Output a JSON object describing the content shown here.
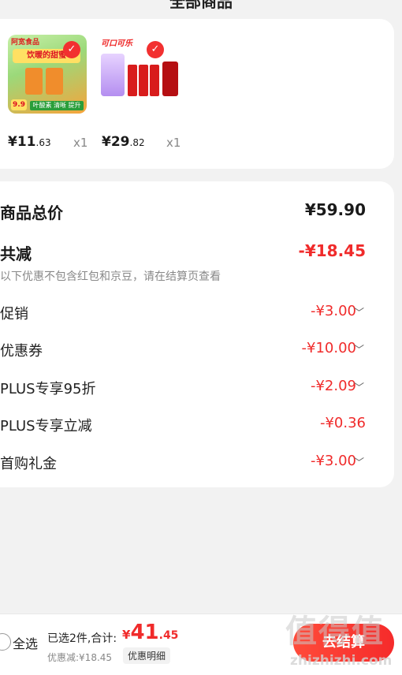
{
  "header": {
    "title": "全部商品"
  },
  "products": [
    {
      "brand": "阿宽食品",
      "banner": "饮暖的甜蜜",
      "price_main": "¥11",
      "price_cents": ".63",
      "qty": "x1",
      "tag": "9.9",
      "slogan": "叶酸素 清晰 提升"
    },
    {
      "brand": "可口可乐",
      "price_main": "¥29",
      "price_cents": ".82",
      "qty": "x1"
    }
  ],
  "summary": {
    "total_label": "商品总价",
    "total_value": "¥59.90",
    "reduce_label": "共减",
    "reduce_value": "-¥18.45",
    "note": "以下优惠不包含红包和京豆，请在结算页查看",
    "discounts": [
      {
        "label": "促销",
        "value": "-¥3.00",
        "expandable": true
      },
      {
        "label": "优惠券",
        "value": "-¥10.00",
        "expandable": true
      },
      {
        "label": "PLUS专享95折",
        "value": "-¥2.09",
        "expandable": true
      },
      {
        "label": "PLUS专享立减",
        "value": "-¥0.36",
        "expandable": false
      },
      {
        "label": "首购礼金",
        "value": "-¥3.00",
        "expandable": true
      }
    ]
  },
  "bottom_bar": {
    "select_all": "全选",
    "selected_info": "已选2件,合计:",
    "total_currency": "¥",
    "total_int": "41",
    "total_dec": ".45",
    "discount_info": "优惠减:¥18.45",
    "detail_button": "优惠明细",
    "checkout_button": "去结算"
  },
  "watermark": {
    "text": "值得值",
    "url": "zhizhizhi.com"
  },
  "colors": {
    "accent": "#f02b2b",
    "background": "#f2f2f2"
  }
}
